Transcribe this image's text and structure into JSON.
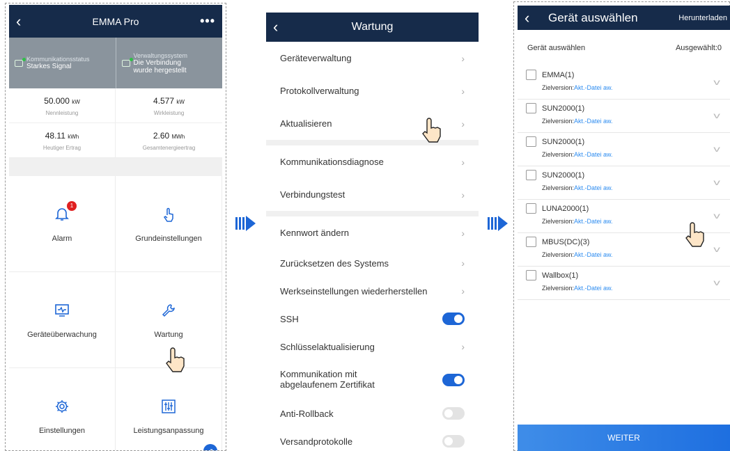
{
  "screen1": {
    "title": "EMMA Pro",
    "more_icon": "more-icon",
    "status": [
      {
        "label": "Kommunikationsstatus",
        "value": "Starkes Signal"
      },
      {
        "label": "Verwaltungssystem",
        "value": "Die Verbindung wurde hergestellt"
      }
    ],
    "stats": [
      {
        "value": "50.000",
        "unit": "kW",
        "label": "Nennleistung"
      },
      {
        "value": "4.577",
        "unit": "kW",
        "label": "Wirkleistung"
      },
      {
        "value": "48.11",
        "unit": "kWh",
        "label": "Heutiger Ertrag"
      },
      {
        "value": "2.60",
        "unit": "MWh",
        "label": "Gesamtenergieertrag"
      }
    ],
    "tiles": [
      {
        "label": "Alarm",
        "icon": "alarm-bell-icon",
        "badge": "1"
      },
      {
        "label": "Grundeinstellungen",
        "icon": "touch-icon"
      },
      {
        "label": "Geräteüberwachung",
        "icon": "monitor-icon"
      },
      {
        "label": "Wartung",
        "icon": "wrench-icon"
      },
      {
        "label": "Einstellungen",
        "icon": "gear-icon"
      },
      {
        "label": "Leistungsanpassung",
        "icon": "sliders-icon"
      }
    ]
  },
  "screen2": {
    "title": "Wartung",
    "groups": [
      [
        {
          "label": "Geräteverwaltung",
          "type": "chevron"
        },
        {
          "label": "Protokollverwaltung",
          "type": "chevron"
        },
        {
          "label": "Aktualisieren",
          "type": "chevron"
        }
      ],
      [
        {
          "label": "Kommunikationsdiagnose",
          "type": "chevron"
        },
        {
          "label": "Verbindungstest",
          "type": "chevron"
        }
      ],
      [
        {
          "label": "Kennwort ändern",
          "type": "chevron"
        },
        {
          "label": "Zurücksetzen des Systems",
          "type": "chevron"
        },
        {
          "label": "Werkseinstellungen wiederherstellen",
          "type": "chevron"
        },
        {
          "label": "SSH",
          "type": "toggle",
          "on": true
        },
        {
          "label": "Schlüsselaktualisierung",
          "type": "chevron"
        },
        {
          "label": "Kommunikation mit abgelaufenem Zertifikat",
          "type": "toggle",
          "on": true
        },
        {
          "label": "Anti-Rollback",
          "type": "toggle",
          "on": false
        },
        {
          "label": "Versandprotokolle",
          "type": "toggle",
          "on": false
        }
      ]
    ]
  },
  "screen3": {
    "title": "Gerät auswählen",
    "action": "Herunterladen",
    "header_left": "Gerät auswählen",
    "header_right": "Ausgewählt:0",
    "version_label": "Zielversion:",
    "version_link": "Akt.-Datei aw.",
    "devices": [
      "EMMA(1)",
      "SUN2000(1)",
      "SUN2000(1)",
      "SUN2000(1)",
      "LUNA2000(1)",
      "MBUS(DC)(3)",
      "Wallbox(1)"
    ],
    "button": "WEITER"
  },
  "colors": {
    "nav": "#162b4a",
    "accent": "#1d66d6",
    "status_bar": "#8a949d"
  }
}
